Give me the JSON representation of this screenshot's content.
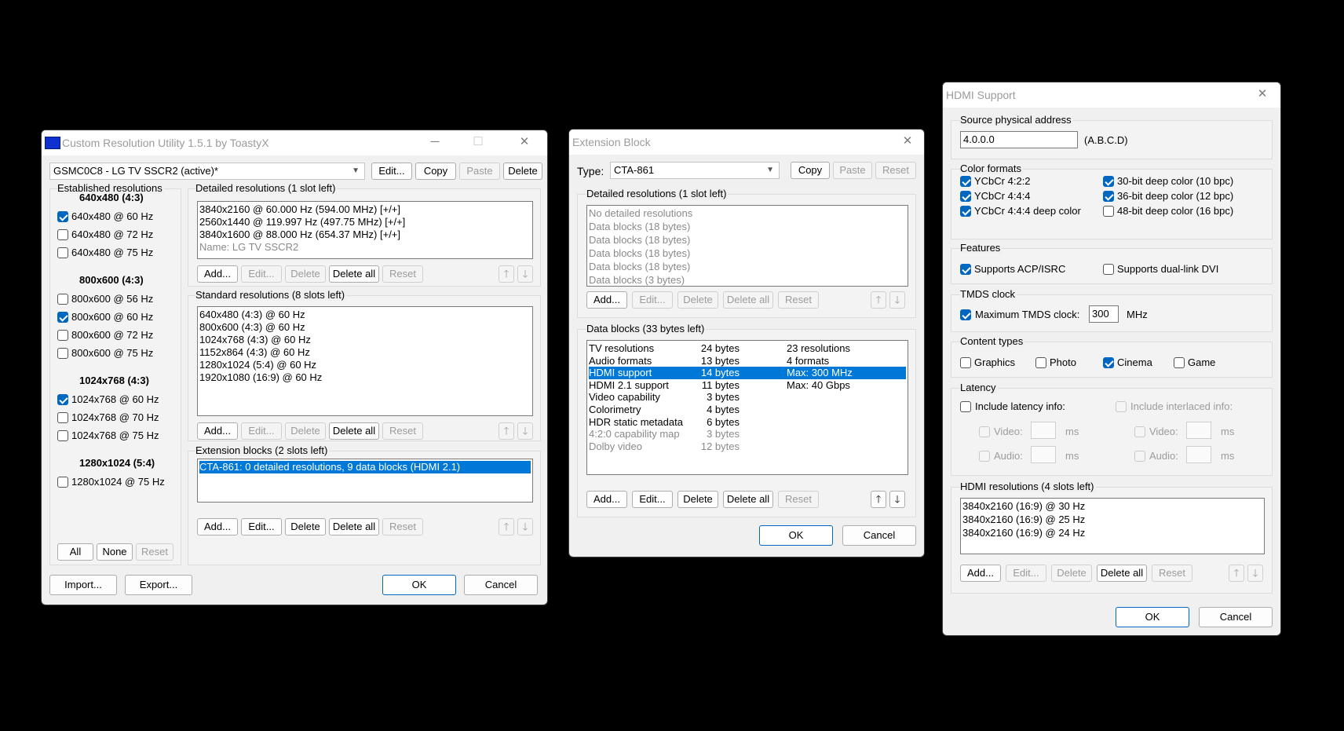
{
  "cru": {
    "title": "Custom Resolution Utility 1.5.1 by ToastyX",
    "monitor": "GSMC0C8 - LG TV SSCR2 (active)*",
    "top_buttons": {
      "edit": "Edit...",
      "copy": "Copy",
      "paste": "Paste",
      "delete": "Delete"
    },
    "established": {
      "label": "Established resolutions",
      "groups": [
        {
          "heading": "640x480 (4:3)",
          "items": [
            {
              "label": "640x480 @ 60 Hz",
              "checked": true
            },
            {
              "label": "640x480 @ 72 Hz",
              "checked": false
            },
            {
              "label": "640x480 @ 75 Hz",
              "checked": false
            }
          ]
        },
        {
          "heading": "800x600 (4:3)",
          "items": [
            {
              "label": "800x600 @ 56 Hz",
              "checked": false
            },
            {
              "label": "800x600 @ 60 Hz",
              "checked": true
            },
            {
              "label": "800x600 @ 72 Hz",
              "checked": false
            },
            {
              "label": "800x600 @ 75 Hz",
              "checked": false
            }
          ]
        },
        {
          "heading": "1024x768 (4:3)",
          "items": [
            {
              "label": "1024x768 @ 60 Hz",
              "checked": true
            },
            {
              "label": "1024x768 @ 70 Hz",
              "checked": false
            },
            {
              "label": "1024x768 @ 75 Hz",
              "checked": false
            }
          ]
        },
        {
          "heading": "1280x1024 (5:4)",
          "items": [
            {
              "label": "1280x1024 @ 75 Hz",
              "checked": false
            }
          ]
        }
      ],
      "buttons": {
        "all": "All",
        "none": "None",
        "reset": "Reset"
      }
    },
    "detailed": {
      "label": "Detailed resolutions (1 slot left)",
      "rows": [
        "3840x2160 @ 60.000 Hz (594.00 MHz) [+/+]",
        "2560x1440 @ 119.997 Hz (497.75 MHz) [+/+]",
        "3840x1600 @ 88.000 Hz (654.37 MHz) [+/+]",
        "Name: LG TV SSCR2"
      ]
    },
    "standard": {
      "label": "Standard resolutions (8 slots left)",
      "rows": [
        "640x480 (4:3) @ 60 Hz",
        "800x600 (4:3) @ 60 Hz",
        "1024x768 (4:3) @ 60 Hz",
        "1152x864 (4:3) @ 60 Hz",
        "1280x1024 (5:4) @ 60 Hz",
        "1920x1080 (16:9) @ 60 Hz"
      ]
    },
    "extension": {
      "label": "Extension blocks (2 slots left)",
      "rows": [
        "CTA-861: 0 detailed resolutions, 9 data blocks (HDMI 2.1)"
      ]
    },
    "list_buttons": {
      "add": "Add...",
      "edit": "Edit...",
      "delete": "Delete",
      "delete_all": "Delete all",
      "reset": "Reset",
      "up": "🡑",
      "down": "🡓"
    },
    "bottom": {
      "import": "Import...",
      "export": "Export...",
      "ok": "OK",
      "cancel": "Cancel"
    }
  },
  "ext": {
    "title": "Extension Block",
    "type_label": "Type:",
    "type_value": "CTA-861",
    "top_buttons": {
      "copy": "Copy",
      "paste": "Paste",
      "reset": "Reset"
    },
    "detailed": {
      "label": "Detailed resolutions (1 slot left)",
      "rows": [
        "No detailed resolutions",
        "Data blocks (18 bytes)",
        "Data blocks (18 bytes)",
        "Data blocks (18 bytes)",
        "Data blocks (18 bytes)",
        "Data blocks (3 bytes)"
      ]
    },
    "data_blocks": {
      "label": "Data blocks (33 bytes left)",
      "rows": [
        {
          "name": "TV resolutions",
          "size": "24 bytes",
          "info": "23 resolutions"
        },
        {
          "name": "Audio formats",
          "size": "13 bytes",
          "info": "4 formats"
        },
        {
          "name": "HDMI support",
          "size": "14 bytes",
          "info": "Max: 300 MHz"
        },
        {
          "name": "HDMI 2.1 support",
          "size": "11 bytes",
          "info": "Max: 40 Gbps"
        },
        {
          "name": "Video capability",
          "size": "3 bytes",
          "info": ""
        },
        {
          "name": "Colorimetry",
          "size": "4 bytes",
          "info": ""
        },
        {
          "name": "HDR static metadata",
          "size": "6 bytes",
          "info": ""
        },
        {
          "name": "4:2:0 capability map",
          "size": "3 bytes",
          "info": ""
        },
        {
          "name": "Dolby video",
          "size": "12 bytes",
          "info": ""
        }
      ]
    },
    "bottom": {
      "ok": "OK",
      "cancel": "Cancel"
    }
  },
  "hdmi": {
    "title": "HDMI Support",
    "source": {
      "label": "Source physical address",
      "value": "4.0.0.0",
      "hint": "(A.B.C.D)"
    },
    "color_formats": {
      "label": "Color formats",
      "items": [
        {
          "label": "YCbCr 4:2:2",
          "checked": true
        },
        {
          "label": "YCbCr 4:4:4",
          "checked": true
        },
        {
          "label": "YCbCr 4:4:4 deep color",
          "checked": true
        },
        {
          "label": "30-bit deep color (10 bpc)",
          "checked": true
        },
        {
          "label": "36-bit deep color (12 bpc)",
          "checked": true
        },
        {
          "label": "48-bit deep color (16 bpc)",
          "checked": false
        }
      ]
    },
    "features": {
      "label": "Features",
      "items": [
        {
          "label": "Supports ACP/ISRC",
          "checked": true
        },
        {
          "label": "Supports dual-link DVI",
          "checked": false
        }
      ]
    },
    "tmds": {
      "label": "TMDS clock",
      "checkbox": "Maximum TMDS clock:",
      "value": "300",
      "unit": "MHz"
    },
    "content_types": {
      "label": "Content types",
      "items": [
        {
          "label": "Graphics",
          "checked": false
        },
        {
          "label": "Photo",
          "checked": false
        },
        {
          "label": "Cinema",
          "checked": true
        },
        {
          "label": "Game",
          "checked": false
        }
      ]
    },
    "latency": {
      "label": "Latency",
      "include": "Include latency info:",
      "include_interlaced": "Include interlaced info:",
      "video": "Video:",
      "audio": "Audio:",
      "unit": "ms"
    },
    "resolutions": {
      "label": "HDMI resolutions (4 slots left)",
      "rows": [
        "3840x2160 (16:9) @ 30 Hz",
        "3840x2160 (16:9) @ 25 Hz",
        "3840x2160 (16:9) @ 24 Hz"
      ]
    },
    "bottom": {
      "ok": "OK",
      "cancel": "Cancel"
    }
  }
}
